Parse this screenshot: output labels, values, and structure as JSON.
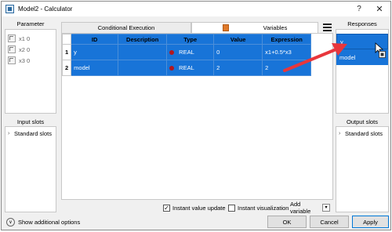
{
  "window": {
    "title": "Model2 - Calculator",
    "help_label": "?",
    "close_label": "✕"
  },
  "parameter_panel": {
    "title": "Parameter",
    "items": [
      {
        "label": "x1  0"
      },
      {
        "label": "x2  0"
      },
      {
        "label": "x3  0"
      }
    ]
  },
  "input_slots": {
    "title": "Input slots",
    "tree_label": "Standard slots"
  },
  "tabs": [
    {
      "label": "Conditional Execution",
      "active": false
    },
    {
      "label": "Variables",
      "active": true
    }
  ],
  "table": {
    "columns": [
      "ID",
      "Description",
      "Type",
      "Value",
      "Expression"
    ],
    "rows": [
      {
        "num": "1",
        "id": "y",
        "description": "",
        "type": "REAL",
        "value": "0",
        "expression": "x1+0.5*x3"
      },
      {
        "num": "2",
        "id": "model",
        "description": "",
        "type": "REAL",
        "value": "2",
        "expression": "2"
      }
    ],
    "type_dot_color": "#b3171f",
    "selection_color": "#1874d8"
  },
  "bottom_controls": {
    "instant_value_update": {
      "label": "Instant value update",
      "checked": true
    },
    "instant_visualization": {
      "label": "Instant visualization",
      "checked": false
    },
    "add_variable_label": "Add variable"
  },
  "responses": {
    "title": "Responses",
    "items": [
      {
        "label": "y"
      },
      {
        "label": "model"
      }
    ]
  },
  "output_slots": {
    "title": "Output slots",
    "tree_label": "Standard slots"
  },
  "footer": {
    "show_additional_options": "Show additional options",
    "ok_label": "OK",
    "cancel_label": "Cancel",
    "apply_label": "Apply"
  },
  "annotation": {
    "arrow_color": "#e8363c"
  }
}
